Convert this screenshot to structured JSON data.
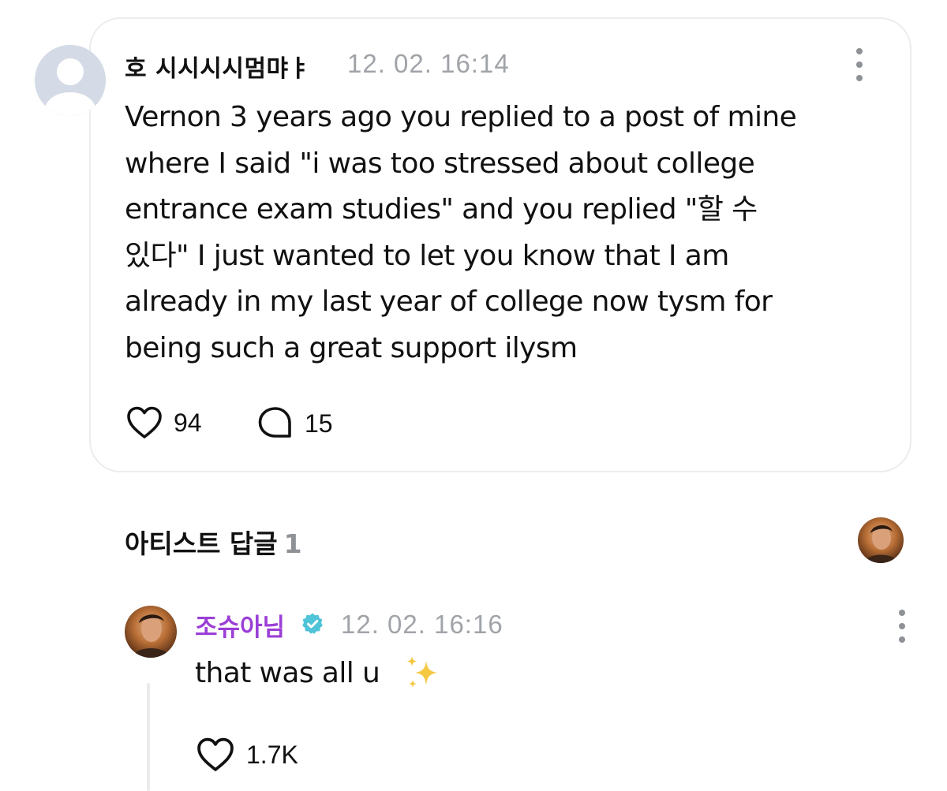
{
  "post": {
    "author": "호 시시시시멈먀ㅑ",
    "timestamp": "12. 02. 16:14",
    "body": "Vernon 3 years ago you replied to a post of mine\nwhere I said \"i was too stressed about college\nentrance exam studies\" and you replied \"할 수\n있다\" I just wanted to let you know that I am\nalready in my last year of college now tysm for\nbeing such a great support ilysm",
    "like_count": "94",
    "comment_count": "15"
  },
  "artist_replies": {
    "title": "아티스트 답글",
    "count": "1"
  },
  "reply": {
    "author": "조슈아님",
    "timestamp": "12. 02. 16:16",
    "text": "that was all u",
    "like_count": "1.7K"
  },
  "icons": {
    "like": "heart-outline-icon",
    "comment": "speech-bubble-icon",
    "more": "vertical-dots-icon",
    "verified": "verified-badge-icon",
    "emoji": "sparkles-icon"
  },
  "colors": {
    "accent_name": "#9b3fd6",
    "verified": "#4fc3d7",
    "meta_gray": "#a0a3a8",
    "card_border": "#ececec",
    "sparkles": "#f5c842"
  }
}
